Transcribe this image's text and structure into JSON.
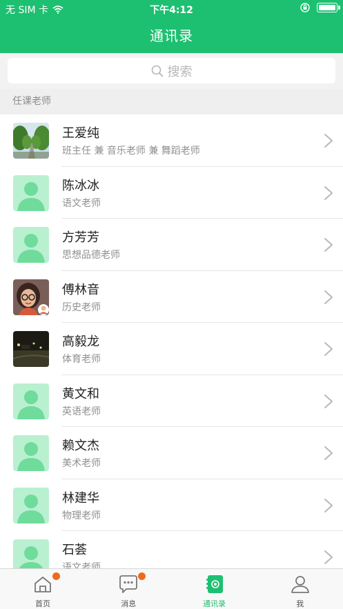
{
  "status_bar": {
    "carrier": "无 SIM 卡",
    "time": "下午4:12"
  },
  "nav": {
    "title": "通讯录"
  },
  "search": {
    "placeholder": "搜索"
  },
  "section": {
    "title": "任课老师"
  },
  "contacts": [
    {
      "name": "王爱纯",
      "role": "班主任 兼 音乐老师 兼 舞蹈老师",
      "avatar": "tree-road-photo"
    },
    {
      "name": "陈冰冰",
      "role": "语文老师",
      "avatar": "default-person"
    },
    {
      "name": "方芳芳",
      "role": "思想品德老师",
      "avatar": "default-person"
    },
    {
      "name": "傅林音",
      "role": "历史老师",
      "avatar": "cartoon-girl"
    },
    {
      "name": "高毅龙",
      "role": "体育老师",
      "avatar": "night-street-photo"
    },
    {
      "name": "黄文和",
      "role": "英语老师",
      "avatar": "default-person"
    },
    {
      "name": "赖文杰",
      "role": "美术老师",
      "avatar": "default-person"
    },
    {
      "name": "林建华",
      "role": "物理老师",
      "avatar": "default-person"
    },
    {
      "name": "石荟",
      "role": "语文老师",
      "avatar": "default-person"
    }
  ],
  "tabs": [
    {
      "label": "首页",
      "icon": "home-icon",
      "badge": true
    },
    {
      "label": "消息",
      "icon": "message-icon",
      "badge": true
    },
    {
      "label": "通讯录",
      "icon": "contacts-icon",
      "active": true
    },
    {
      "label": "我",
      "icon": "profile-icon"
    }
  ],
  "colors": {
    "brand": "#1dc070",
    "badge": "#f06a1d",
    "avatar_bg": "#a8ecc5"
  }
}
